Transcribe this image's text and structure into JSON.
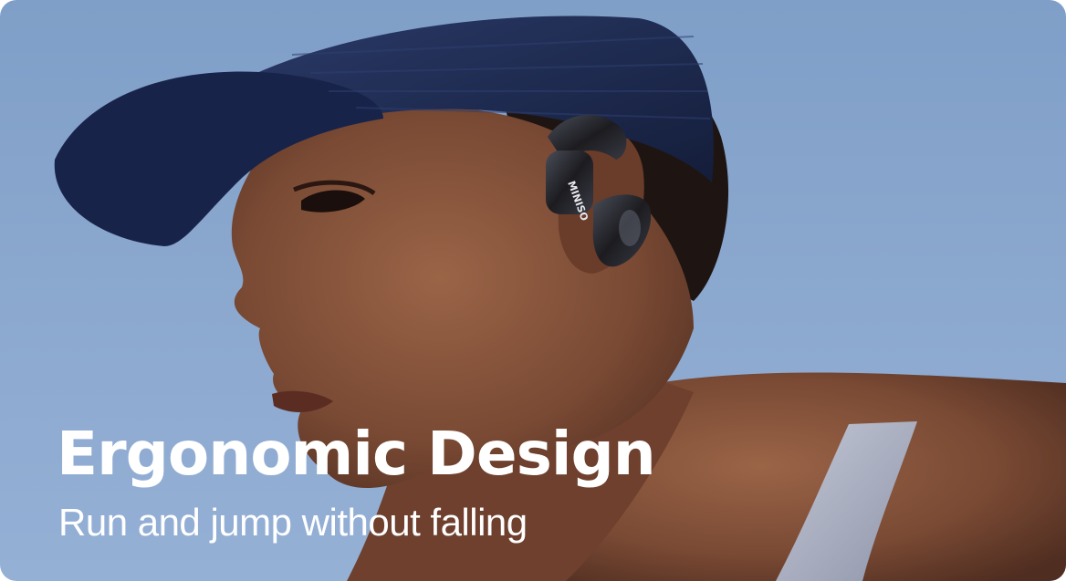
{
  "banner": {
    "headline": "Ergonomic Design",
    "subline": "Run and jump without falling",
    "earbud_brand": "MINISO"
  },
  "colors": {
    "sky": "#89a6cd",
    "visor": "#1d2a4f",
    "skin": "#7a4a34",
    "earbud": "#1c1c20",
    "tank_top": "#a9aec0",
    "text": "#ffffff"
  },
  "icons": []
}
